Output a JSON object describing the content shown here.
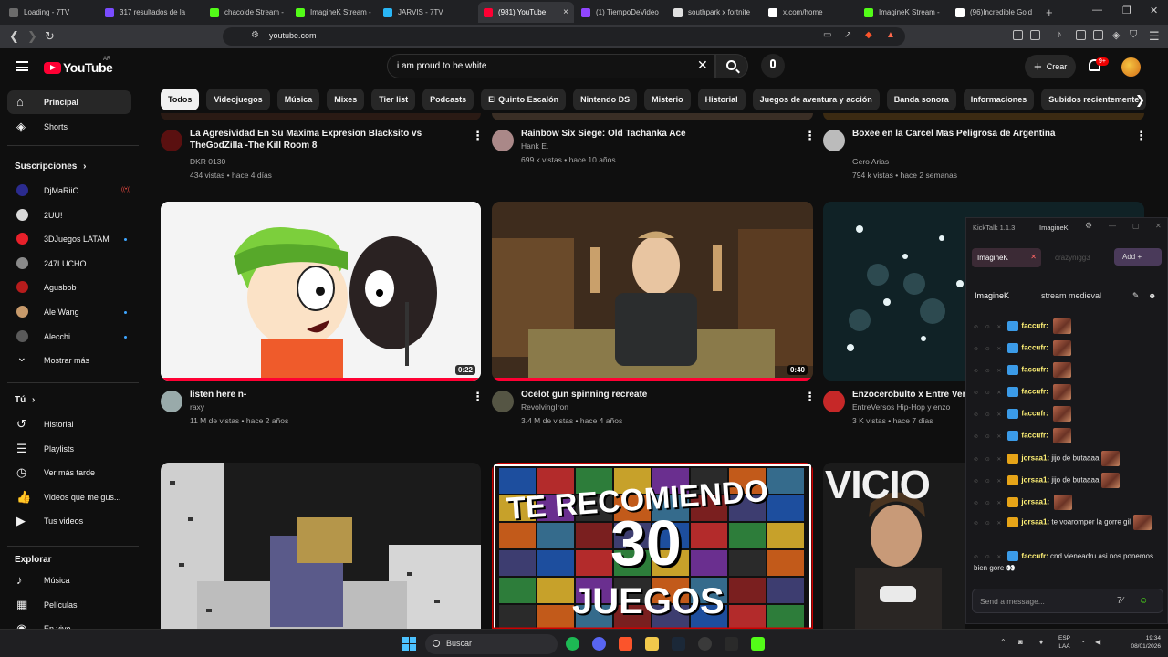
{
  "browser": {
    "tabs": [
      {
        "label": "Loading - 7TV",
        "color": "#6b6b6b"
      },
      {
        "label": "317 resultados de la",
        "color": "#7a4cff"
      },
      {
        "label": "chacoide Stream -",
        "color": "#53fc18"
      },
      {
        "label": "ImagineK Stream -",
        "color": "#53fc18"
      },
      {
        "label": "JARVIS - 7TV",
        "color": "#29b6f6"
      },
      {
        "label": "(981) YouTube",
        "color": "#ff0033"
      },
      {
        "label": "(1) TiempoDeVideo",
        "color": "#9146ff"
      },
      {
        "label": "southpark x fortnite",
        "color": "#e0e0e0"
      },
      {
        "label": "x.com/home",
        "color": "#ffffff"
      },
      {
        "label": "ImagineK Stream -",
        "color": "#53fc18"
      },
      {
        "label": "(96)Incredible Gold",
        "color": "#ffffff"
      }
    ],
    "new_tab": "+",
    "active_tab_close": "×",
    "url": "youtube.com"
  },
  "youtube": {
    "logo_text": "YouTube",
    "country": "AR",
    "search_value": "i am proud to be white",
    "create_label": "Crear",
    "notif_count": "9+",
    "chips": [
      "Todos",
      "Videojuegos",
      "Música",
      "Mixes",
      "Tier list",
      "Podcasts",
      "El Quinto Escalón",
      "Nintendo DS",
      "Misterio",
      "Historial",
      "Juegos de aventura y acción",
      "Banda sonora",
      "Informaciones",
      "Subidos recientemente"
    ]
  },
  "sidebar": {
    "main": [
      {
        "label": "Principal",
        "icon": "home-icon"
      },
      {
        "label": "Shorts",
        "icon": "shorts-icon"
      }
    ],
    "subs_heading": "Suscripciones",
    "subs": [
      {
        "label": "DjMaRiiO",
        "color": "#2b2b8f",
        "live": true
      },
      {
        "label": "2UU!",
        "color": "#d9d9d9"
      },
      {
        "label": "3DJuegos LATAM",
        "color": "#e8202a",
        "dot": true
      },
      {
        "label": "247LUCHO",
        "color": "#8a8a8a"
      },
      {
        "label": "Agusbob",
        "color": "#b71c1c"
      },
      {
        "label": "Ale Wang",
        "color": "#c79a6b",
        "dot": true
      },
      {
        "label": "Alecchi",
        "color": "#5a5a5a",
        "dot": true
      }
    ],
    "show_more": "Mostrar más",
    "you_heading": "Tú",
    "you": [
      {
        "label": "Historial",
        "icon": "history-icon"
      },
      {
        "label": "Playlists",
        "icon": "playlists-icon"
      },
      {
        "label": "Ver más tarde",
        "icon": "watch-later-icon"
      },
      {
        "label": "Videos que me gus...",
        "icon": "liked-videos-icon"
      },
      {
        "label": "Tus videos",
        "icon": "your-videos-icon"
      }
    ],
    "explore_heading": "Explorar",
    "explore": [
      {
        "label": "Música",
        "icon": "music-icon"
      },
      {
        "label": "Películas",
        "icon": "movies-icon"
      },
      {
        "label": "En vivo",
        "icon": "live-icon"
      }
    ]
  },
  "videos_top": [
    {
      "title": "La Agresividad En Su Maxima Expresion Blacksito  vs TheGodZilla  -The Kill Room 8",
      "channel": "DKR 0130",
      "views": "434 vistas",
      "age": "hace 4 días",
      "avatar": "#5a1010"
    },
    {
      "title": "Rainbow Six Siege: Old Tachanka Ace",
      "channel": "Hank E.",
      "views": "699 k vistas",
      "age": "hace 10 años",
      "avatar": "#a88"
    },
    {
      "title": "Boxee en la Carcel Mas Peligrosa de Argentina",
      "channel": "Gero Arias",
      "views": "794 k vistas",
      "age": "hace 2 semanas",
      "avatar": "#bbb"
    }
  ],
  "videos_mid": [
    {
      "title": "listen here n-",
      "channel": "raxy",
      "views": "11 M de vistas",
      "age": "hace 2 años",
      "duration": "0:22",
      "progress": 1.0,
      "avatar": "#9aa"
    },
    {
      "title": "Ocelot gun spinning recreate",
      "channel": "RevolvingIron",
      "views": "3.4 M de vistas",
      "age": "hace 4 años",
      "duration": "0:40",
      "progress": 1.0,
      "avatar": "#554"
    },
    {
      "title": "Enzocerobulto x Entre Vers Córdoba.",
      "channel": "EntreVersos Hip-Hop y enzo",
      "views": "3 K vistas",
      "age": "hace 7 días",
      "avatar": "#c62828"
    }
  ],
  "thumb_text": {
    "line1": "TE RECOMIENDO",
    "line2": "30",
    "line3": "JUEGOS",
    "vicio": "VICIO"
  },
  "kicktalk": {
    "title": "KickTalk 1.1.3",
    "top_tab": "ImagineK",
    "channel_tab": "ImagineK",
    "channel_tab2": "crazynigg3",
    "add_label": "Add +",
    "streamer": "ImagineK",
    "stream_title": "stream medieval",
    "messages": [
      {
        "user": "faccufr",
        "text": "",
        "emote": true
      },
      {
        "user": "faccufr",
        "text": "",
        "emote": true
      },
      {
        "user": "faccufr",
        "text": "",
        "emote": true
      },
      {
        "user": "faccufr",
        "text": "",
        "emote": true
      },
      {
        "user": "faccufr",
        "text": "",
        "emote": true
      },
      {
        "user": "faccufr",
        "text": "",
        "emote": true
      },
      {
        "user": "jorsaa1",
        "text": "jijo de butaaaa",
        "emote": true
      },
      {
        "user": "jorsaa1",
        "text": "jijo de butaaaa",
        "emote": true
      },
      {
        "user": "jorsaa1",
        "text": "",
        "emote": true
      },
      {
        "user": "jorsaa1",
        "text": "te voaromper la gorre gil",
        "emote": true
      },
      {
        "user": "faccufr",
        "text": "cnd vieneadru asi nos ponemos bien gore 👀",
        "emote": false
      }
    ],
    "input_placeholder": "Send a message..."
  },
  "taskbar": {
    "search_label": "Buscar",
    "lang1": "ESP",
    "lang2": "LAA",
    "time": "19:34",
    "date": "08/01/2026"
  }
}
